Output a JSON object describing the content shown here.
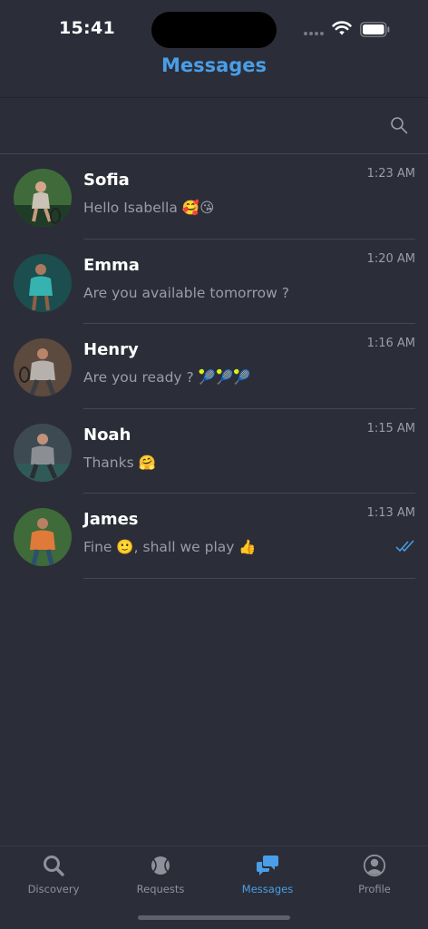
{
  "status_bar": {
    "time": "15:41"
  },
  "header": {
    "title": "Messages"
  },
  "search": {
    "icon": "search-icon"
  },
  "conversations": [
    {
      "name": "Sofia",
      "preview": "Hello Isabella 🥰😘",
      "time": "1:23 AM",
      "read_receipt": false,
      "avatar_colors": [
        "#3f6b3a",
        "#c9c2b5"
      ]
    },
    {
      "name": "Emma",
      "preview": "Are you available tomorrow ?",
      "time": "1:20 AM",
      "read_receipt": false,
      "avatar_colors": [
        "#1d4e4f",
        "#36b3b0"
      ]
    },
    {
      "name": "Henry",
      "preview": "Are you ready ? 🎾🎾🎾",
      "time": "1:16 AM",
      "read_receipt": false,
      "avatar_colors": [
        "#5d4a3e",
        "#b6b1ad"
      ]
    },
    {
      "name": "Noah",
      "preview": "Thanks 🤗",
      "time": "1:15 AM",
      "read_receipt": false,
      "avatar_colors": [
        "#3e4a52",
        "#8b8f93"
      ]
    },
    {
      "name": "James",
      "preview": "Fine 🙂, shall we play 👍",
      "time": "1:13 AM",
      "read_receipt": true,
      "avatar_colors": [
        "#3f6a3a",
        "#e07a3b"
      ]
    }
  ],
  "tabs": [
    {
      "label": "Discovery",
      "icon": "discovery-search-icon",
      "active": false
    },
    {
      "label": "Requests",
      "icon": "tennis-ball-icon",
      "active": false
    },
    {
      "label": "Messages",
      "icon": "chat-bubbles-icon",
      "active": true
    },
    {
      "label": "Profile",
      "icon": "profile-icon",
      "active": false
    }
  ],
  "colors": {
    "background": "#2b2e38",
    "accent": "#4a9ee8",
    "muted_text": "#9a9da6",
    "divider": "#44474f"
  }
}
